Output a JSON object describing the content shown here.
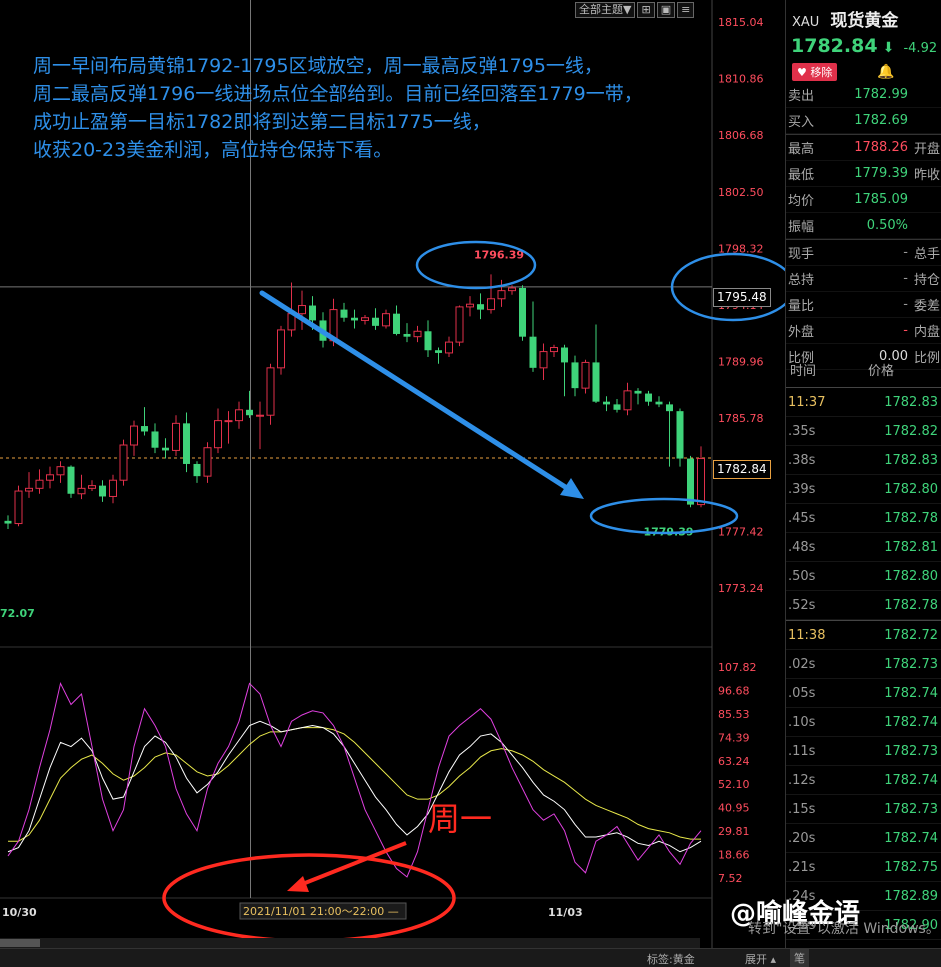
{
  "toolbar": {
    "theme_label": "全部主题▼"
  },
  "annotation": {
    "lines": [
      "周一早间布局黄锦1792-1795区域放空，周一最高反弹1795一线，",
      "周二最高反弹1796一线进场点位全部给到。目前已经回落至1779一带，",
      "成功止盈第一目标1782即将到达第二目标1775一线，",
      "收获20-23美金利润，高位持仓保持下看。"
    ],
    "monday_label": "周一"
  },
  "price_axis": [
    "1815.04",
    "1810.86",
    "1806.68",
    "1802.50",
    "1798.32",
    "1794.14",
    "1789.96",
    "1785.78",
    "1781.60",
    "1777.42",
    "1773.24"
  ],
  "osc_axis": [
    "107.82",
    "96.68",
    "85.53",
    "74.39",
    "63.24",
    "52.10",
    "40.95",
    "29.81",
    "18.66",
    "7.52"
  ],
  "labels": {
    "high": "1796.39",
    "low": "1779.39",
    "crosshair_price": "1795.48",
    "current_price": "1782.84",
    "left_low": "72.07",
    "date_left": "10/30",
    "date_right": "11/03",
    "crosshair_time": "2021/11/01 21:00～22:00"
  },
  "colors": {
    "up": "#e0304a",
    "down": "#3fd37a",
    "annot": "#2e8fe8",
    "circle_red": "#ff2a20"
  },
  "chart_data": {
    "type": "candlestick",
    "ylim": [
      1771.5,
      1816.5
    ],
    "candles": [
      [
        1778.2,
        1778.6,
        1777.6,
        1778.0
      ],
      [
        1778.0,
        1780.8,
        1777.8,
        1780.4
      ],
      [
        1780.4,
        1781.8,
        1779.9,
        1780.6
      ],
      [
        1780.6,
        1782.0,
        1780.2,
        1781.2
      ],
      [
        1781.2,
        1782.2,
        1780.6,
        1781.6
      ],
      [
        1781.6,
        1782.6,
        1781.0,
        1782.2
      ],
      [
        1782.2,
        1782.3,
        1779.9,
        1780.2
      ],
      [
        1780.2,
        1781.6,
        1779.8,
        1780.6
      ],
      [
        1780.6,
        1781.2,
        1780.4,
        1780.8
      ],
      [
        1780.8,
        1781.2,
        1779.6,
        1780.0
      ],
      [
        1780.0,
        1781.6,
        1779.5,
        1781.2
      ],
      [
        1781.2,
        1784.2,
        1780.8,
        1783.8
      ],
      [
        1783.8,
        1785.6,
        1783.0,
        1785.2
      ],
      [
        1785.2,
        1786.6,
        1784.5,
        1784.8
      ],
      [
        1784.8,
        1785.4,
        1783.2,
        1783.6
      ],
      [
        1783.6,
        1784.3,
        1782.8,
        1783.4
      ],
      [
        1783.4,
        1786.0,
        1783.0,
        1785.4
      ],
      [
        1785.4,
        1786.2,
        1781.8,
        1782.4
      ],
      [
        1782.4,
        1782.6,
        1781.0,
        1781.5
      ],
      [
        1781.5,
        1784.0,
        1781.0,
        1783.6
      ],
      [
        1783.6,
        1786.5,
        1783.2,
        1785.6
      ],
      [
        1785.6,
        1786.3,
        1783.9,
        1785.6
      ],
      [
        1785.6,
        1787.0,
        1785.0,
        1786.4
      ],
      [
        1786.4,
        1787.8,
        1785.8,
        1786.0
      ],
      [
        1786.0,
        1787.0,
        1783.5,
        1786.0
      ],
      [
        1786.0,
        1789.8,
        1785.3,
        1789.5
      ],
      [
        1789.5,
        1792.6,
        1789.0,
        1792.3
      ],
      [
        1792.3,
        1795.8,
        1791.8,
        1793.5
      ],
      [
        1793.5,
        1795.2,
        1792.3,
        1794.1
      ],
      [
        1794.1,
        1794.8,
        1792.3,
        1793.0
      ],
      [
        1793.0,
        1793.6,
        1791.0,
        1791.5
      ],
      [
        1791.5,
        1794.6,
        1791.1,
        1793.8
      ],
      [
        1793.8,
        1794.3,
        1792.9,
        1793.2
      ],
      [
        1793.2,
        1793.8,
        1792.4,
        1793.0
      ],
      [
        1793.0,
        1793.4,
        1792.7,
        1793.2
      ],
      [
        1793.2,
        1793.9,
        1792.3,
        1792.6
      ],
      [
        1792.6,
        1793.8,
        1792.4,
        1793.5
      ],
      [
        1793.5,
        1794.1,
        1791.9,
        1792.0
      ],
      [
        1792.0,
        1792.8,
        1791.4,
        1791.8
      ],
      [
        1791.8,
        1792.6,
        1791.4,
        1792.2
      ],
      [
        1792.2,
        1793.0,
        1790.3,
        1790.8
      ],
      [
        1790.8,
        1791.0,
        1789.8,
        1790.6
      ],
      [
        1790.6,
        1791.8,
        1790.3,
        1791.4
      ],
      [
        1791.4,
        1794.1,
        1791.1,
        1794.0
      ],
      [
        1794.0,
        1794.8,
        1793.3,
        1794.2
      ],
      [
        1794.2,
        1795.0,
        1793.1,
        1793.8
      ],
      [
        1793.8,
        1796.4,
        1793.5,
        1794.6
      ],
      [
        1794.6,
        1796.0,
        1794.0,
        1795.2
      ],
      [
        1795.2,
        1795.6,
        1794.9,
        1795.4
      ],
      [
        1795.4,
        1795.6,
        1791.5,
        1791.8
      ],
      [
        1791.8,
        1794.4,
        1789.2,
        1789.5
      ],
      [
        1789.5,
        1791.3,
        1788.6,
        1790.7
      ],
      [
        1790.7,
        1791.2,
        1790.3,
        1791.0
      ],
      [
        1791.0,
        1791.2,
        1787.4,
        1789.9
      ],
      [
        1789.9,
        1790.4,
        1787.4,
        1788.0
      ],
      [
        1788.0,
        1790.1,
        1787.6,
        1789.9
      ],
      [
        1789.9,
        1792.7,
        1786.9,
        1787.0
      ],
      [
        1787.0,
        1787.4,
        1786.3,
        1786.8
      ],
      [
        1786.8,
        1787.2,
        1786.2,
        1786.4
      ],
      [
        1786.4,
        1788.4,
        1786.0,
        1787.8
      ],
      [
        1787.8,
        1788.0,
        1786.8,
        1787.6
      ],
      [
        1787.6,
        1787.8,
        1786.7,
        1787.0
      ],
      [
        1787.0,
        1787.4,
        1786.6,
        1786.8
      ],
      [
        1786.8,
        1787.0,
        1782.2,
        1786.3
      ],
      [
        1786.3,
        1786.5,
        1782.2,
        1782.8
      ],
      [
        1782.8,
        1783.0,
        1779.2,
        1779.4
      ],
      [
        1779.4,
        1783.7,
        1779.2,
        1782.8
      ]
    ],
    "osc_ylim": [
      0,
      112
    ],
    "osc_fast": [
      18,
      25,
      40,
      60,
      78,
      100,
      90,
      95,
      70,
      45,
      30,
      40,
      70,
      88,
      80,
      70,
      50,
      38,
      30,
      50,
      62,
      70,
      82,
      100,
      95,
      80,
      70,
      82,
      85,
      87,
      86,
      80,
      70,
      55,
      40,
      30,
      20,
      12,
      8,
      20,
      40,
      60,
      75,
      80,
      84,
      88,
      83,
      72,
      60,
      50,
      40,
      35,
      38,
      30,
      15,
      10,
      25,
      28,
      32,
      24,
      16,
      22,
      28,
      20,
      14,
      24,
      30
    ],
    "osc_mid": [
      20,
      22,
      30,
      45,
      60,
      72,
      70,
      74,
      68,
      55,
      45,
      46,
      58,
      70,
      75,
      72,
      65,
      55,
      48,
      52,
      58,
      66,
      73,
      80,
      82,
      80,
      77,
      78,
      79,
      80,
      79,
      76,
      70,
      62,
      54,
      46,
      40,
      33,
      28,
      32,
      38,
      48,
      58,
      66,
      70,
      75,
      76,
      72,
      66,
      60,
      53,
      47,
      44,
      40,
      33,
      27,
      27,
      28,
      29,
      27,
      24,
      23,
      25,
      23,
      20,
      22,
      25
    ],
    "osc_slow": [
      25,
      25,
      28,
      35,
      45,
      55,
      60,
      64,
      66,
      62,
      57,
      54,
      56,
      60,
      65,
      67,
      66,
      62,
      58,
      56,
      57,
      61,
      66,
      71,
      75,
      77,
      77,
      78,
      79,
      79,
      79,
      78,
      76,
      72,
      67,
      62,
      57,
      52,
      47,
      45,
      45,
      47,
      51,
      56,
      60,
      65,
      68,
      69,
      68,
      66,
      63,
      59,
      56,
      53,
      49,
      45,
      42,
      40,
      38,
      36,
      33,
      31,
      30,
      29,
      27,
      26,
      26
    ]
  },
  "quote": {
    "code": "XAU",
    "name": "现货黄金",
    "price": "1782.84",
    "change": "-4.92",
    "remove_label": "移除",
    "rows": [
      {
        "k": "卖出",
        "v": "1782.99",
        "c": "green",
        "k2": ""
      },
      {
        "k": "买入",
        "v": "1782.69",
        "c": "green",
        "k2": ""
      },
      {
        "k": "最高",
        "v": "1788.26",
        "c": "red",
        "k2": "开盘"
      },
      {
        "k": "最低",
        "v": "1779.39",
        "c": "green",
        "k2": "昨收"
      },
      {
        "k": "均价",
        "v": "1785.09",
        "c": "green",
        "k2": ""
      },
      {
        "k": "振幅",
        "v": "0.50%",
        "c": "green",
        "k2": ""
      },
      {
        "k": "现手",
        "v": "-",
        "c": "grey",
        "k2": "总手"
      },
      {
        "k": "总持",
        "v": "-",
        "c": "grey",
        "k2": "持仓"
      },
      {
        "k": "量比",
        "v": "-",
        "c": "grey",
        "k2": "委差"
      },
      {
        "k": "外盘",
        "v": "-",
        "c": "red",
        "k2": "内盘"
      },
      {
        "k": "比例",
        "v": "0.00",
        "c": "white",
        "k2": "比例"
      }
    ],
    "ticks_header": [
      "时间",
      "价格"
    ],
    "ticks": [
      {
        "t": "11:37",
        "p": "1782.83",
        "full": true
      },
      {
        "t": ".35s",
        "p": "1782.82"
      },
      {
        "t": ".38s",
        "p": "1782.83"
      },
      {
        "t": ".39s",
        "p": "1782.80"
      },
      {
        "t": ".45s",
        "p": "1782.78"
      },
      {
        "t": ".48s",
        "p": "1782.81"
      },
      {
        "t": ".50s",
        "p": "1782.80"
      },
      {
        "t": ".52s",
        "p": "1782.78"
      },
      {
        "t": "11:38",
        "p": "1782.72",
        "full": true
      },
      {
        "t": ".02s",
        "p": "1782.73"
      },
      {
        "t": ".05s",
        "p": "1782.74"
      },
      {
        "t": ".10s",
        "p": "1782.74"
      },
      {
        "t": ".11s",
        "p": "1782.73"
      },
      {
        "t": ".12s",
        "p": "1782.74"
      },
      {
        "t": ".15s",
        "p": "1782.73"
      },
      {
        "t": ".20s",
        "p": "1782.74"
      },
      {
        "t": ".21s",
        "p": "1782.75"
      },
      {
        "t": ".24s",
        "p": "1782.89"
      },
      {
        "t": ".25s",
        "p": "1782.90"
      }
    ]
  },
  "status": {
    "tag_label": "标签:黄金",
    "expand_label": "展开 ▴",
    "pen_label": "笔"
  },
  "watermark": "@喻峰金语",
  "win_activation": "转到\"设置\"以激活 Windows。"
}
